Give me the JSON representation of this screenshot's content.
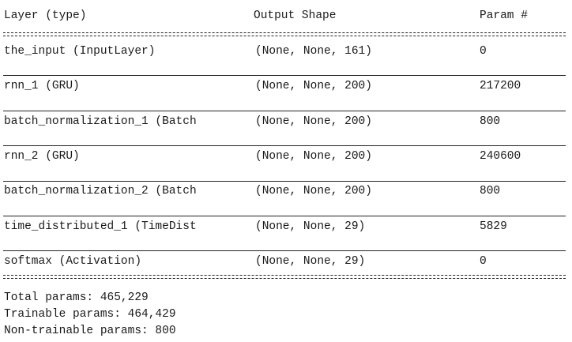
{
  "headers": {
    "layer": "Layer (type)",
    "shape": "Output Shape",
    "param": "Param #"
  },
  "rows": [
    {
      "layer": "the_input (InputLayer)",
      "shape": "(None, None, 161)",
      "param": "0"
    },
    {
      "layer": "rnn_1 (GRU)",
      "shape": "(None, None, 200)",
      "param": "217200"
    },
    {
      "layer": "batch_normalization_1 (Batch",
      "shape": "(None, None, 200)",
      "param": "800"
    },
    {
      "layer": "rnn_2 (GRU)",
      "shape": "(None, None, 200)",
      "param": "240600"
    },
    {
      "layer": "batch_normalization_2 (Batch",
      "shape": "(None, None, 200)",
      "param": "800"
    },
    {
      "layer": "time_distributed_1 (TimeDist",
      "shape": "(None, None, 29)",
      "param": "5829"
    },
    {
      "layer": "softmax (Activation)",
      "shape": "(None, None, 29)",
      "param": "0"
    }
  ],
  "totals": {
    "total": "Total params: 465,229",
    "trainable": "Trainable params: 464,429",
    "non_trainable": "Non-trainable params: 800"
  }
}
